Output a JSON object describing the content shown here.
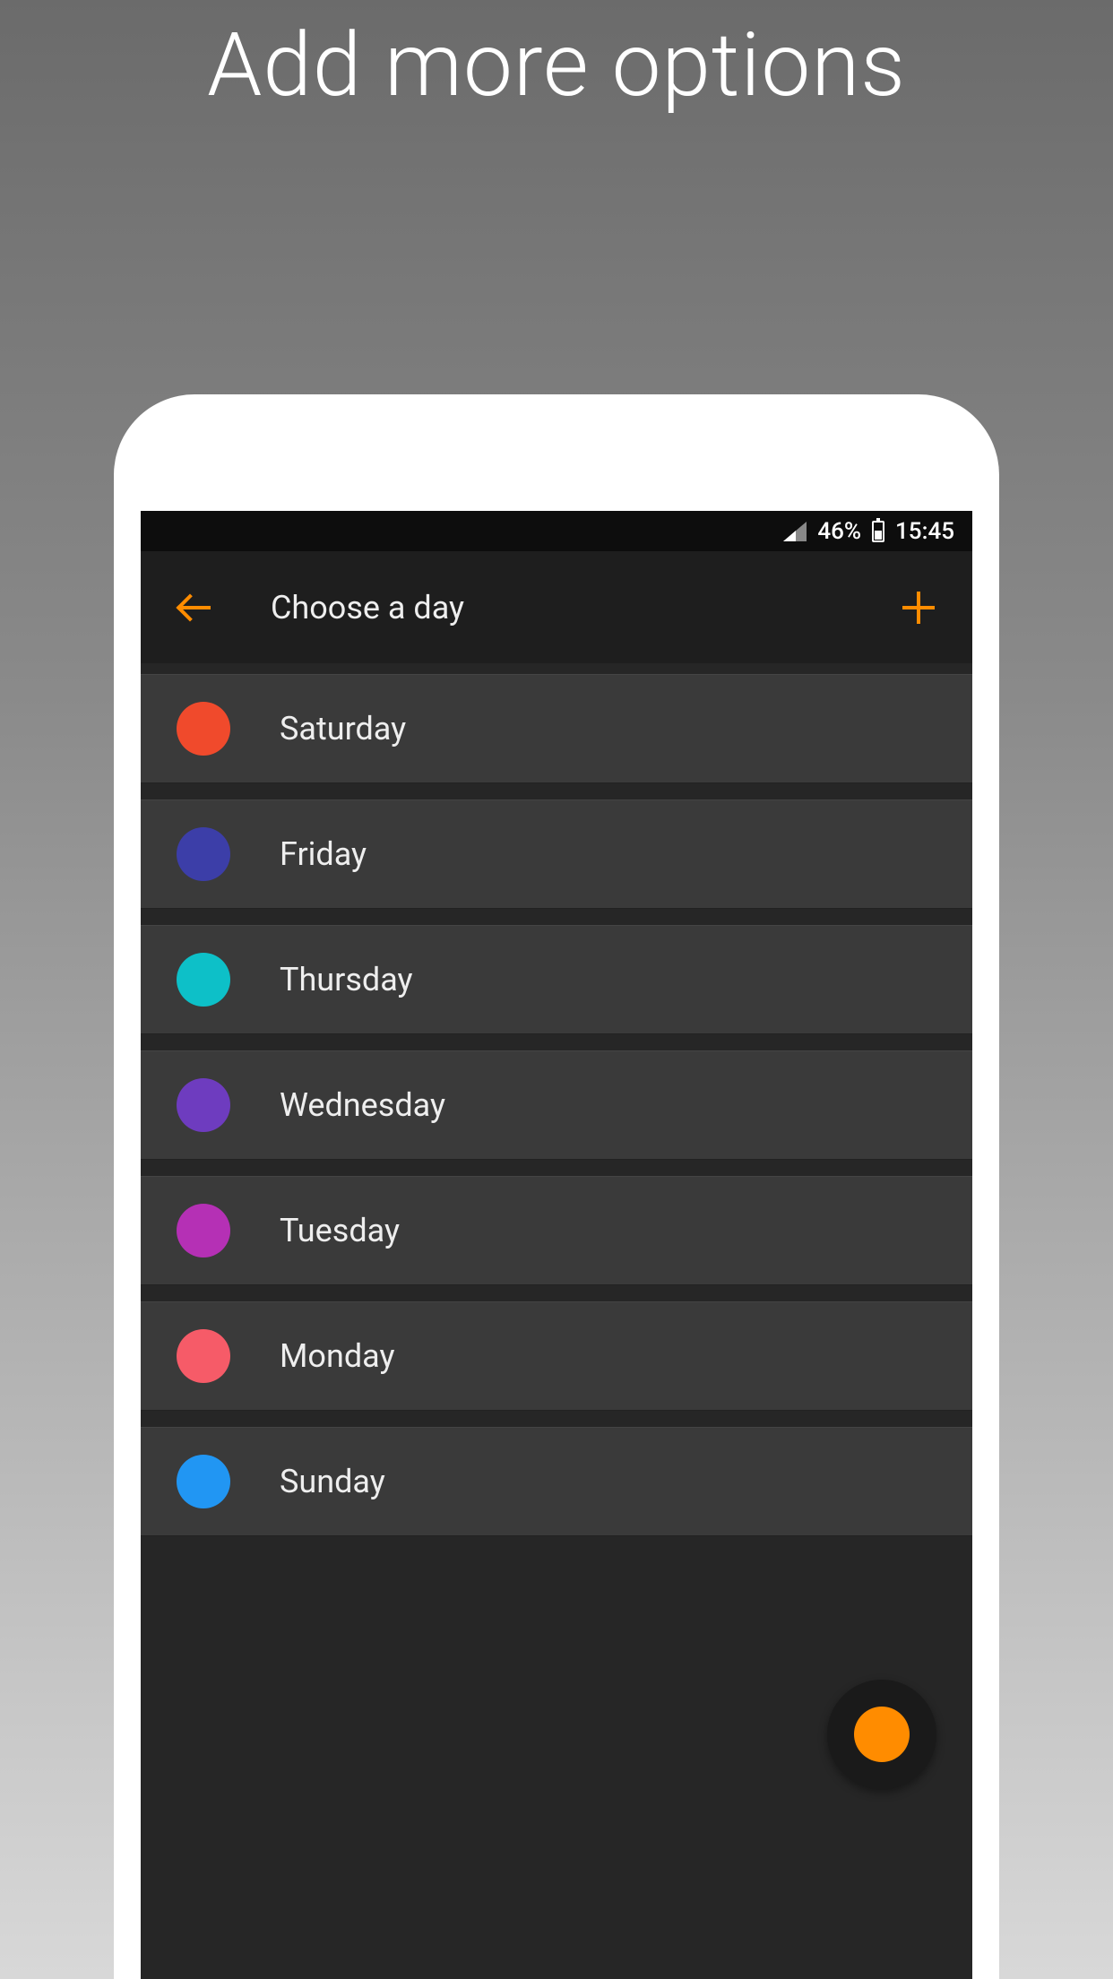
{
  "promo": {
    "title": "Add more options"
  },
  "status_bar": {
    "battery_percent": "46%",
    "time": "15:45"
  },
  "app_bar": {
    "title": "Choose a day"
  },
  "days": [
    {
      "label": "Saturday",
      "color": "#f04a2c"
    },
    {
      "label": "Friday",
      "color": "#3c3ea8"
    },
    {
      "label": "Thursday",
      "color": "#0dc0c8"
    },
    {
      "label": "Wednesday",
      "color": "#6e3cbf"
    },
    {
      "label": "Tuesday",
      "color": "#b530b5"
    },
    {
      "label": "Monday",
      "color": "#f65b68"
    },
    {
      "label": "Sunday",
      "color": "#2196f3"
    }
  ]
}
